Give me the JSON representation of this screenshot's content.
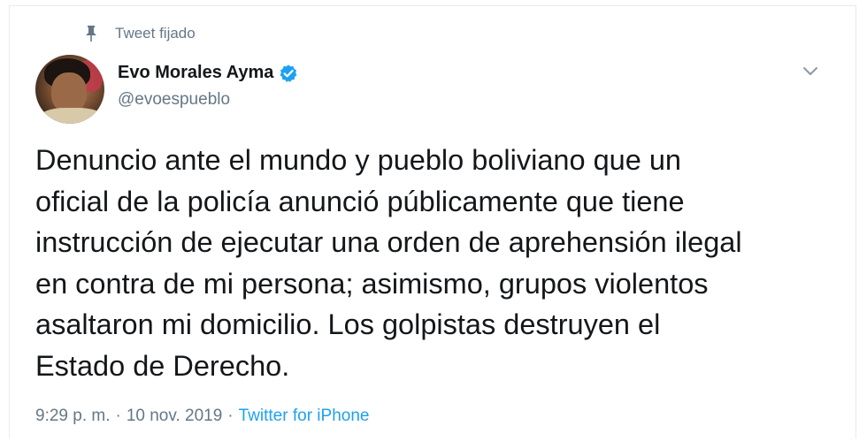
{
  "pinned": {
    "label": "Tweet fijado"
  },
  "author": {
    "name": "Evo Morales Ayma",
    "handle": "@evoespueblo",
    "verified": true
  },
  "tweet": {
    "text": "Denuncio ante el mundo y pueblo boliviano que un\noficial de la policía anunció públicamente que tiene\ninstrucción de ejecutar una orden de aprehensión ilegal\nen contra de mi persona; asimismo, grupos violentos\nasaltaron mi domicilio. Los golpistas destruyen el\nEstado de Derecho."
  },
  "meta": {
    "time": "9:29 p. m.",
    "separator": "·",
    "date": "10 nov. 2019",
    "source": "Twitter for iPhone"
  },
  "colors": {
    "accent": "#1da1f2",
    "muted": "#657786",
    "text": "#14171a"
  },
  "icons": {
    "pin": "pin-icon",
    "verified": "verified-badge-icon",
    "menu": "chevron-down-icon"
  }
}
